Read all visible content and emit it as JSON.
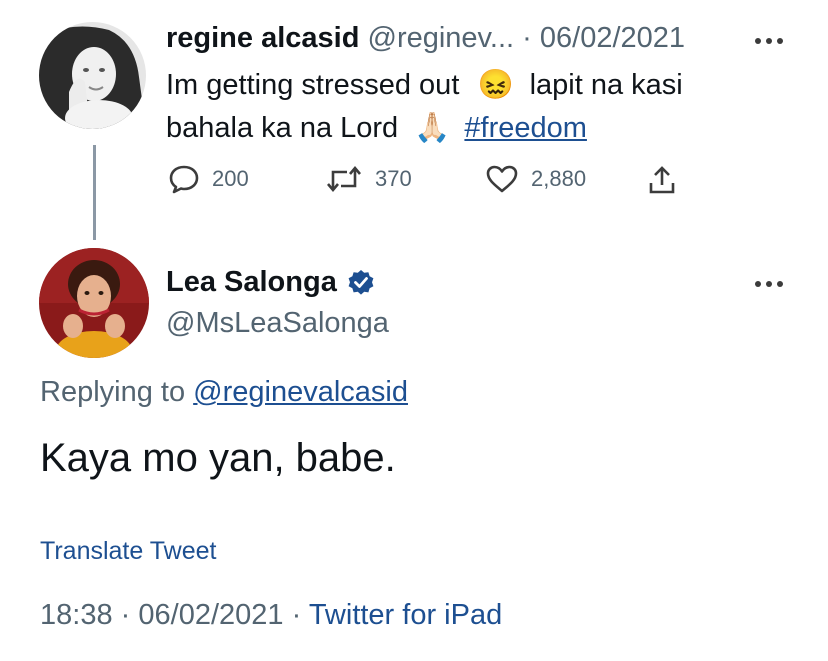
{
  "parent_tweet": {
    "display_name": "regine alcasid",
    "handle": "@reginev...",
    "separator": "·",
    "date": "06/02/2021",
    "text_line1_start": "Im getting stressed out",
    "emoji1": "😖",
    "text_line1_end": "lapit na kasi",
    "text_line2_start": "bahala ka na Lord",
    "emoji2": "🙏🏻",
    "hashtag": "#freedom",
    "replies": "200",
    "retweets": "370",
    "likes": "2,880"
  },
  "reply_tweet": {
    "display_name": "Lea Salonga",
    "handle": "@MsLeaSalonga",
    "replying_prefix": "Replying to",
    "replying_to": "@reginevalcasid",
    "text": "Kaya mo yan, babe.",
    "translate": "Translate Tweet",
    "time": "18:38",
    "sep1": "·",
    "date": "06/02/2021",
    "sep2": "·",
    "source": "Twitter for iPad"
  },
  "colors": {
    "link": "#1d4f91",
    "muted": "#536471",
    "verified": "#1d4f91",
    "thread_line": "#8b98a5"
  }
}
